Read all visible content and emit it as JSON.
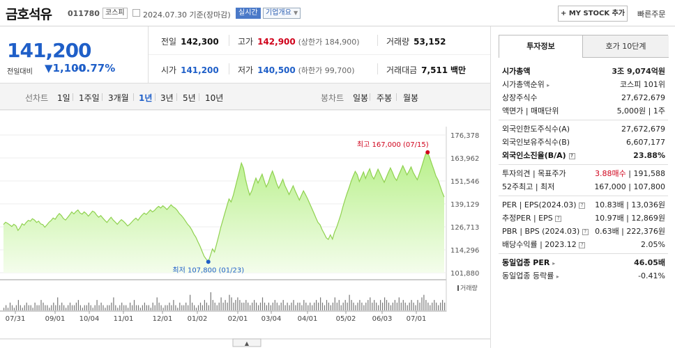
{
  "header": {
    "name": "금호석유",
    "code": "011780",
    "market": "코스피",
    "date": "2024.07.30",
    "basis": "기준(장마감)",
    "realtime": "실시간",
    "overview": "기업개요",
    "mystock": "+ MY STOCK 추가",
    "fast_order": "빠른주문"
  },
  "price": {
    "current": "141,200",
    "change_label": "전일대비",
    "change": "▼1,100",
    "rate": "-0.77%"
  },
  "info": {
    "prev_l": "전일",
    "prev_v": "142,300",
    "high_l": "고가",
    "high_v": "142,900",
    "upper": "(상한가 184,900)",
    "vol_l": "거래량",
    "vol_v": "53,152",
    "open_l": "시가",
    "open_v": "141,200",
    "low_l": "저가",
    "low_v": "140,500",
    "lower": "(하한가 99,700)",
    "amt_l": "거래대금",
    "amt_v": "7,511",
    "amt_u": "백만"
  },
  "periods": {
    "line_label": "선차트",
    "items": [
      "1일",
      "1주일",
      "3개월",
      "1년",
      "3년",
      "5년",
      "10년"
    ],
    "active": "1년",
    "candle_label": "봉차트",
    "candle": [
      "일봉",
      "주봉",
      "월봉"
    ]
  },
  "chart_data": {
    "type": "area",
    "y_ticks": [
      "176,378",
      "163,962",
      "151,546",
      "139,129",
      "126,713",
      "114,296",
      "101,880"
    ],
    "ylim": [
      101880,
      176378
    ],
    "x_ticks": [
      "07/31",
      "09/01",
      "10/04",
      "11/01",
      "12/01",
      "01/02",
      "02/01",
      "03/04",
      "04/01",
      "05/02",
      "06/03",
      "07/01"
    ],
    "max_label": "최고 167,000 (07/15)",
    "min_label": "최저 107,800 (01/23)",
    "volume_label": "거래량",
    "series": [
      {
        "values": [
          128000,
          129200,
          128600,
          127800,
          126900,
          128100,
          127300,
          124800,
          126200,
          128400,
          127600,
          129100,
          130200,
          129800,
          131100,
          130400,
          129100,
          129800,
          128300,
          127900,
          126500,
          127800,
          129200,
          130100,
          131500,
          130800,
          132600,
          133900,
          132800,
          131200,
          130400,
          131800,
          133200,
          134800,
          133700,
          134900,
          135800,
          134200,
          133600,
          134800,
          133900,
          132500,
          133800,
          135200,
          134600,
          133100,
          131900,
          132800,
          131500,
          130200,
          129100,
          130600,
          131900,
          130400,
          129300,
          128100,
          129500,
          130600,
          129700,
          128500,
          127200,
          128100,
          129300,
          130500,
          131400,
          130200,
          131800,
          133100,
          134200,
          133400,
          134600,
          135900,
          134800,
          135600,
          136900,
          137800,
          136900,
          138100,
          137200,
          136100,
          137400,
          138600,
          137500,
          136800,
          135600,
          133900,
          132800,
          131500,
          129800,
          128100,
          126900,
          125100,
          122800,
          121100,
          118600,
          116200,
          113500,
          110800,
          109200,
          107800,
          111200,
          114800,
          113100,
          117400,
          121800,
          126300,
          130200,
          134200,
          138100,
          141800,
          140200,
          143600,
          147900,
          152400,
          156800,
          161200,
          158400,
          152300,
          147800,
          143900,
          146200,
          149800,
          153100,
          150400,
          152800,
          155200,
          151600,
          148300,
          150600,
          154200,
          156900,
          153800,
          150200,
          147600,
          149900,
          152400,
          149100,
          146800,
          144200,
          146500,
          148900,
          146100,
          143700,
          141200,
          143800,
          146200,
          144100,
          141800,
          139300,
          136800,
          134200,
          131600,
          129100,
          127800,
          125200,
          123100,
          120800,
          119900,
          122400,
          120100,
          123800,
          126400,
          129800,
          133100,
          137400,
          141200,
          144600,
          147800,
          151300,
          154100,
          156700,
          154900,
          151200,
          153800,
          156400,
          152900,
          155800,
          158100,
          154400,
          152600,
          155200,
          157900,
          155600,
          153100,
          150800,
          153400,
          156100,
          158600,
          156200,
          153400,
          151800,
          154600,
          157200,
          159800,
          157400,
          154800,
          156900,
          159100,
          156200,
          154100,
          152200,
          155400,
          158800,
          162400,
          166100,
          167000,
          164200,
          160800,
          157600,
          154200,
          152100,
          148800,
          145600,
          142800
        ]
      }
    ],
    "volume": [
      1,
      2,
      1,
      3,
      2,
      1,
      2,
      4,
      2,
      1,
      2,
      3,
      2,
      2,
      1,
      3,
      2,
      2,
      4,
      3,
      2,
      2,
      1,
      2,
      3,
      2,
      5,
      2,
      3,
      2,
      1,
      2,
      3,
      2,
      2,
      3,
      4,
      2,
      1,
      2,
      2,
      3,
      2,
      1,
      2,
      4,
      2,
      3,
      2,
      1,
      2,
      2,
      3,
      5,
      2,
      1,
      2,
      3,
      2,
      2,
      1,
      3,
      2,
      4,
      2,
      2,
      1,
      2,
      3,
      2,
      2,
      1,
      3,
      2,
      5,
      3,
      2,
      1,
      2,
      2,
      3,
      2,
      4,
      2,
      1,
      3,
      2,
      2,
      3,
      2,
      6,
      3,
      2,
      1,
      2,
      3,
      2,
      4,
      3,
      2,
      7,
      4,
      3,
      2,
      3,
      5,
      3,
      4,
      3,
      6,
      5,
      3,
      4,
      5,
      4,
      3,
      3,
      4,
      3,
      2,
      3,
      4,
      3,
      2,
      3,
      5,
      3,
      2,
      3,
      2,
      3,
      4,
      3,
      2,
      3,
      4,
      2,
      3,
      2,
      3,
      4,
      2,
      3,
      3,
      2,
      4,
      3,
      2,
      3,
      2,
      3,
      4,
      3,
      5,
      3,
      2,
      4,
      3,
      2,
      3,
      5,
      3,
      4,
      2,
      3,
      4,
      3,
      6,
      4,
      3,
      2,
      3,
      4,
      3,
      2,
      3,
      4,
      5,
      3,
      4,
      3,
      2,
      4,
      3,
      5,
      4,
      3,
      2,
      3,
      4,
      3,
      5,
      3,
      4,
      3,
      2,
      3,
      4,
      3,
      2,
      4,
      3,
      5,
      6,
      4,
      3,
      2,
      3,
      4,
      3,
      2,
      3,
      4,
      3
    ]
  },
  "tabs": {
    "t1": "투자정보",
    "t2": "호가 10단계"
  },
  "invest": {
    "mcap_l": "시가총액",
    "mcap_v": "3조 9,074억원",
    "rank_l": "시가총액순위",
    "rank_v": "코스피 101위",
    "shares_l": "상장주식수",
    "shares_v": "27,672,679",
    "par_l": "액면가 | 매매단위",
    "par_v": "5,000원 | 1주",
    "fl_l": "외국인한도주식수(A)",
    "fl_v": "27,672,679",
    "fh_l": "외국인보유주식수(B)",
    "fh_v": "6,607,177",
    "fr_l": "외국인소진율(B/A)",
    "fr_v": "23.88%",
    "op_l": "투자의견 | 목표주가",
    "op_v1": "3.88매수",
    "op_v2": "191,588",
    "hl_l": "52주최고 | 최저",
    "hl_v": "167,000 | 107,800",
    "per_l": "PER | EPS(2024.03)",
    "per_v": "10.83배 | 13,036원",
    "eper_l": "추정PER | EPS",
    "eper_v": "10.97배 | 12,869원",
    "pbr_l": "PBR | BPS (2024.03)",
    "pbr_v": "0.63배 | 222,376원",
    "div_l": "배당수익률 | 2023.12",
    "div_v": "2.05%",
    "iper_l": "동일업종 PER",
    "iper_v": "46.05배",
    "irate_l": "동일업종 등락률",
    "irate_v": "-0.41%"
  }
}
